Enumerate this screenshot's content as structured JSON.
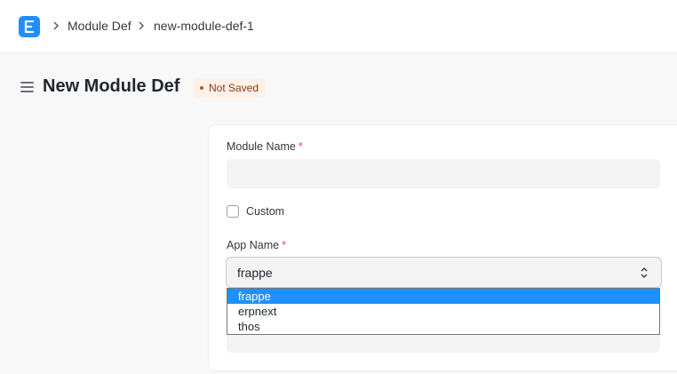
{
  "navbar": {
    "logo_icon": "app-logo-icon",
    "breadcrumbs": [
      "Module Def",
      "new-module-def-1"
    ]
  },
  "header": {
    "title": "New Module Def",
    "status": "Not Saved"
  },
  "form": {
    "module_name": {
      "label": "Module Name",
      "required_mark": "*",
      "value": ""
    },
    "custom": {
      "label": "Custom",
      "checked": false
    },
    "app_name": {
      "label": "App Name",
      "required_mark": "*",
      "value": "frappe",
      "options": [
        "frappe",
        "erpnext",
        "thos"
      ],
      "selected_index": 0
    }
  },
  "colors": {
    "accent": "#1f8fff",
    "selection": "#1e90ff",
    "badge_bg": "#fff1e7",
    "badge_text": "#8b3a12",
    "required": "#e24c4c"
  }
}
